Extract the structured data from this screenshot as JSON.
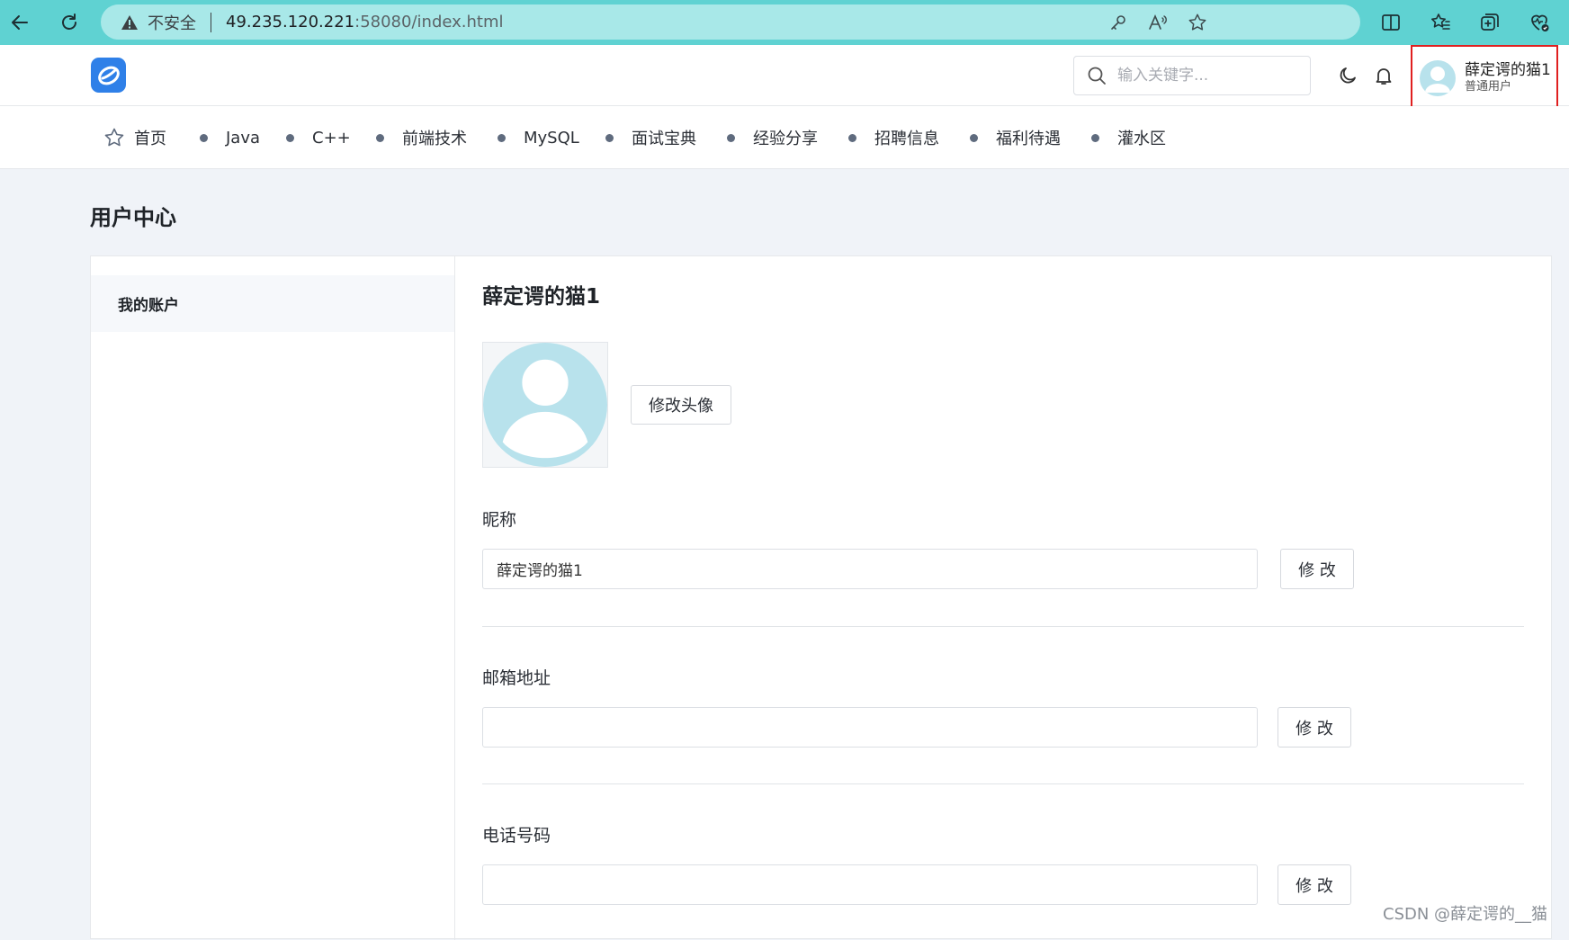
{
  "browser": {
    "insecure_label": "不安全",
    "url_host": "49.235.120.221",
    "url_path": ":58080/index.html"
  },
  "header": {
    "search_placeholder": "输入关键字...",
    "user_name": "薛定谔的猫1",
    "user_role": "普通用户"
  },
  "nav": {
    "items": [
      {
        "label": "首页",
        "icon": "star-icon"
      },
      {
        "label": "Java"
      },
      {
        "label": "C++"
      },
      {
        "label": "前端技术"
      },
      {
        "label": "MySQL"
      },
      {
        "label": "面试宝典"
      },
      {
        "label": "经验分享"
      },
      {
        "label": "招聘信息"
      },
      {
        "label": "福利待遇"
      },
      {
        "label": "灌水区"
      }
    ]
  },
  "page": {
    "title": "用户中心",
    "side_menu": [
      "我的账户"
    ],
    "user_heading": "薛定谔的猫1",
    "change_avatar_label": "修改头像",
    "fields": [
      {
        "label": "昵称",
        "value": "薛定谔的猫1",
        "button": "修 改"
      },
      {
        "label": "邮箱地址",
        "value": "",
        "button": "修 改"
      },
      {
        "label": "电话号码",
        "value": "",
        "button": "修 改"
      }
    ]
  },
  "watermark": "CSDN @薛定谔的__猫",
  "colors": {
    "browser_bar": "#5fd2d2",
    "highlight_border": "#e02020",
    "avatar_fill": "#b8e2ec",
    "logo_blue": "#2f80e8"
  }
}
